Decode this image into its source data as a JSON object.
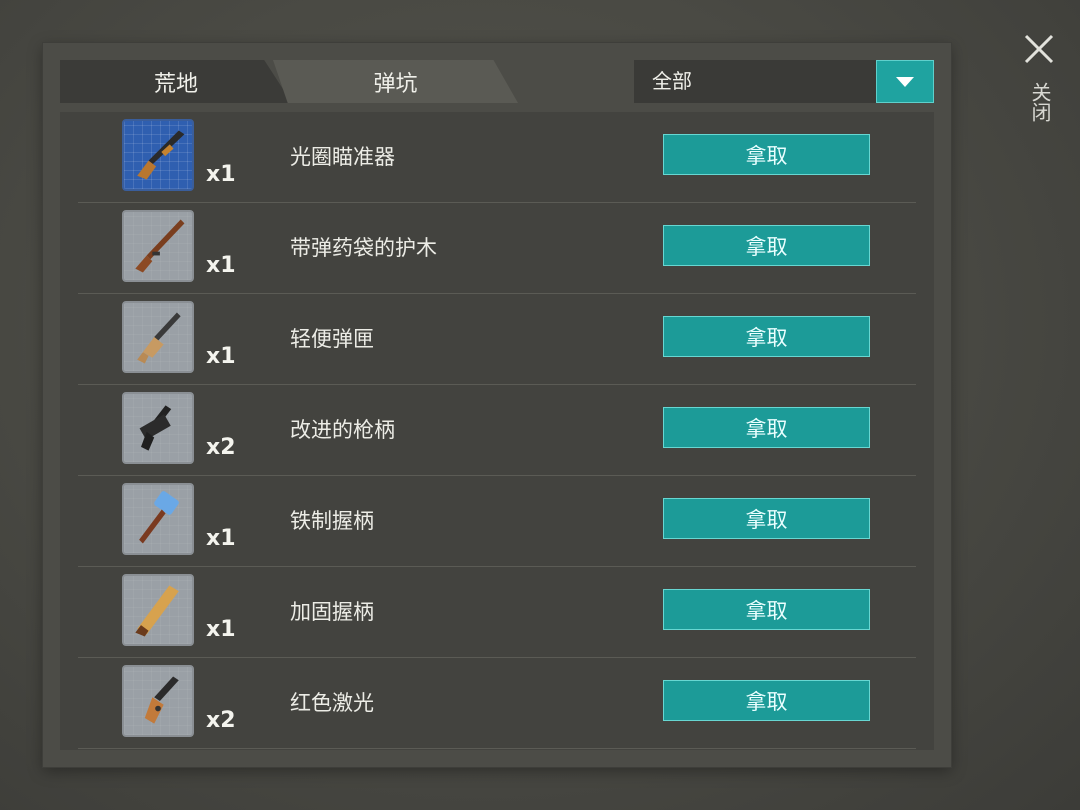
{
  "tabs": [
    {
      "label": "荒地"
    },
    {
      "label": "弹坑"
    }
  ],
  "filter": {
    "selected": "全部"
  },
  "close": {
    "label": "关闭"
  },
  "take_label": "拿取",
  "items": [
    {
      "name": "光圈瞄准器",
      "qty": "x1",
      "icon": "shotgun-icon"
    },
    {
      "name": "带弹药袋的护木",
      "qty": "x1",
      "icon": "lever-rifle-icon"
    },
    {
      "name": "轻便弹匣",
      "qty": "x1",
      "icon": "assault-rifle-icon"
    },
    {
      "name": "改进的枪柄",
      "qty": "x2",
      "icon": "uzi-icon"
    },
    {
      "name": "铁制握柄",
      "qty": "x1",
      "icon": "sledgehammer-icon"
    },
    {
      "name": "加固握柄",
      "qty": "x1",
      "icon": "wooden-plank-icon"
    },
    {
      "name": "红色激光",
      "qty": "x2",
      "icon": "pistol-icon"
    }
  ],
  "colors": {
    "accent": "#1fa3a0",
    "blueprint_blue": "#2f5fb0"
  }
}
